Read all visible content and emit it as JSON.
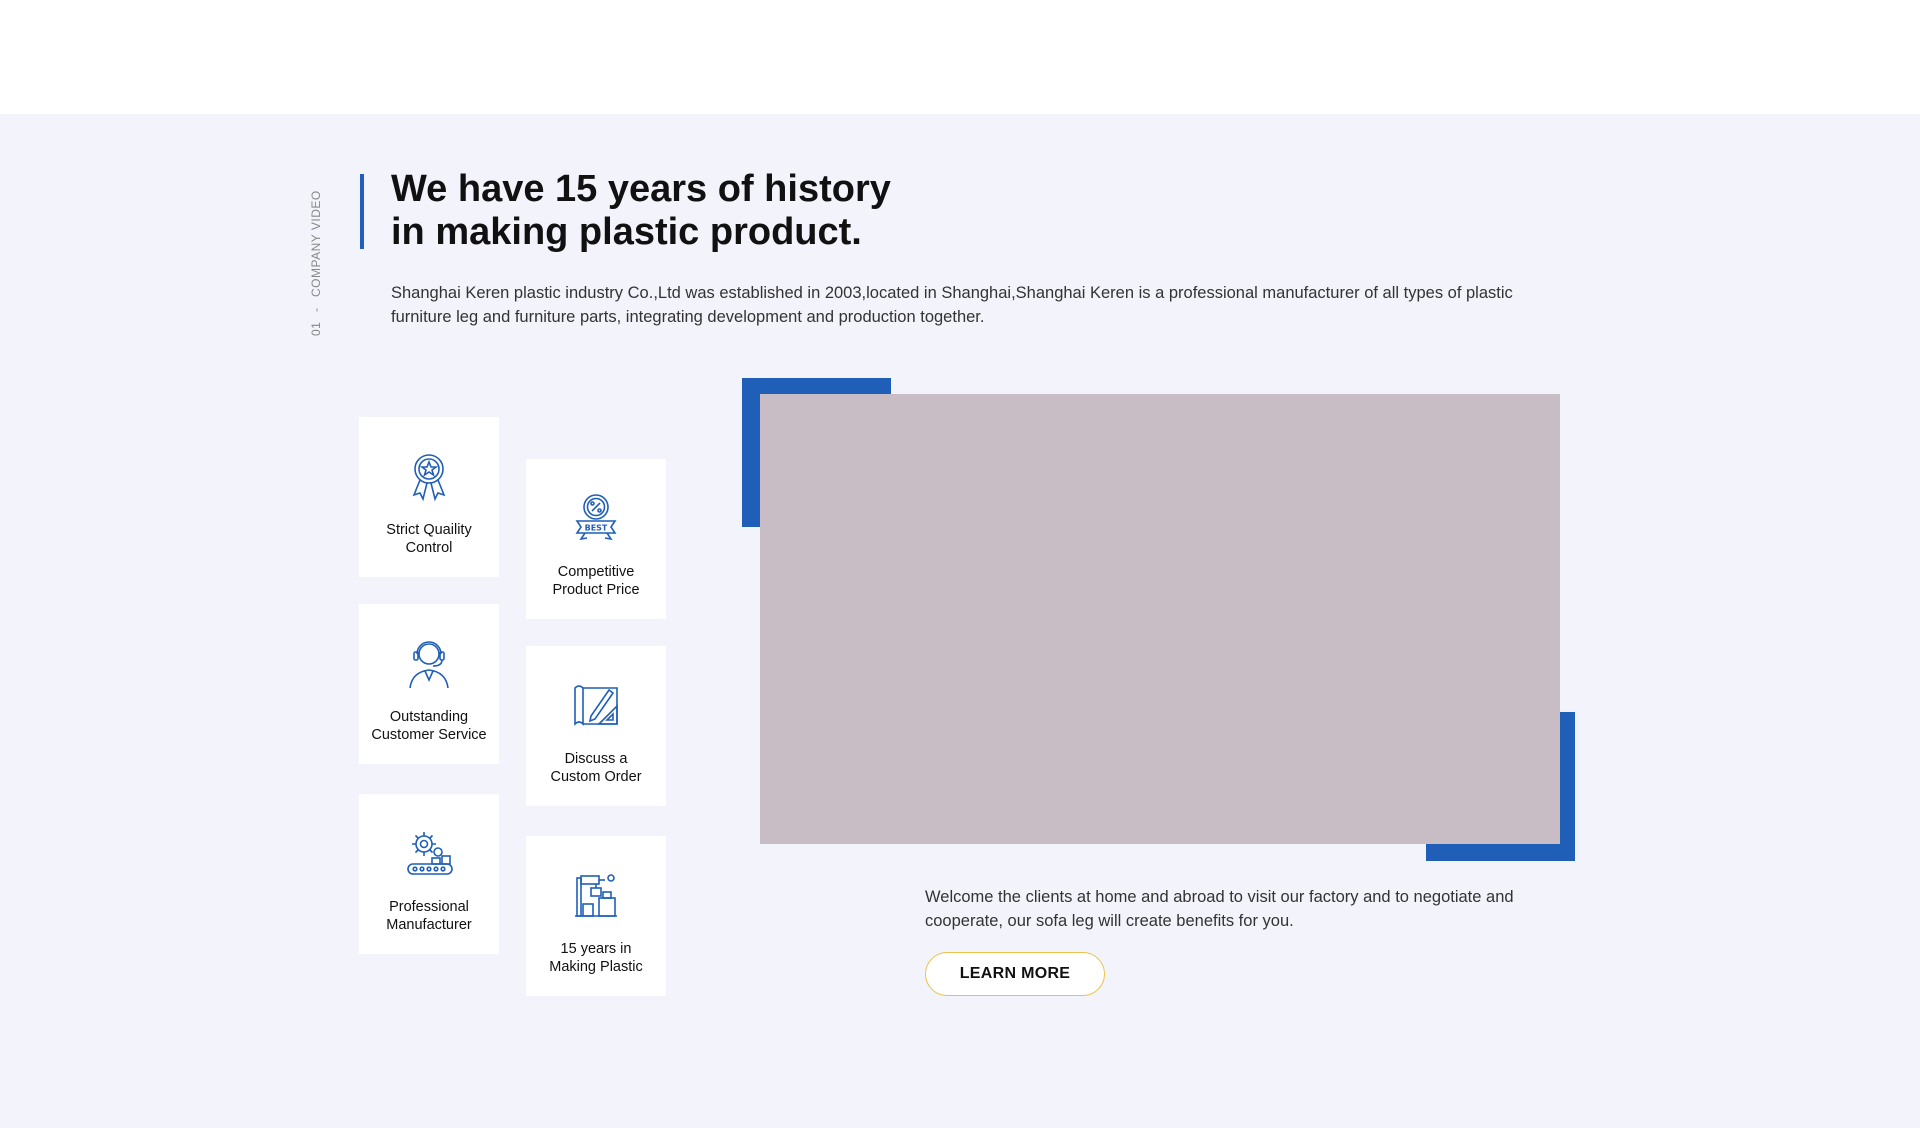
{
  "side_label": {
    "number": "01",
    "separator": "-",
    "text": "COMPANY VIDEO"
  },
  "heading": {
    "line1": "We have 15 years of history",
    "line2": "in making plastic product."
  },
  "intro": "Shanghai Keren plastic industry Co.,Ltd was established in 2003,located in Shanghai,Shanghai Keren is a professional manufacturer of all types of plastic furniture leg and  furniture parts, integrating development and production together.",
  "features": [
    {
      "icon": "award-ribbon-icon",
      "line1": "Strict Quaility",
      "line2": "Control"
    },
    {
      "icon": "best-price-badge-icon",
      "line1": "Competitive",
      "line2": "Product Price"
    },
    {
      "icon": "headset-agent-icon",
      "line1": "Outstanding",
      "line2": "Customer Service"
    },
    {
      "icon": "blueprint-pencil-icon",
      "line1": "Discuss a",
      "line2": "Custom Order"
    },
    {
      "icon": "gear-conveyor-icon",
      "line1": "Professional",
      "line2": "Manufacturer"
    },
    {
      "icon": "factory-machine-icon",
      "line1": "15 years in",
      "line2": "Making Plastic"
    }
  ],
  "welcome": "Welcome the clients at home and abroad  to visit our factory and to negotiate and cooperate, our sofa leg will create benefits for you.",
  "learn_more": "LEARN MORE",
  "colors": {
    "accent_blue": "#1f5fb8",
    "section_bg": "#f2f3fb",
    "video_placeholder": "#c8bdc5",
    "button_border": "#e8c24a"
  }
}
